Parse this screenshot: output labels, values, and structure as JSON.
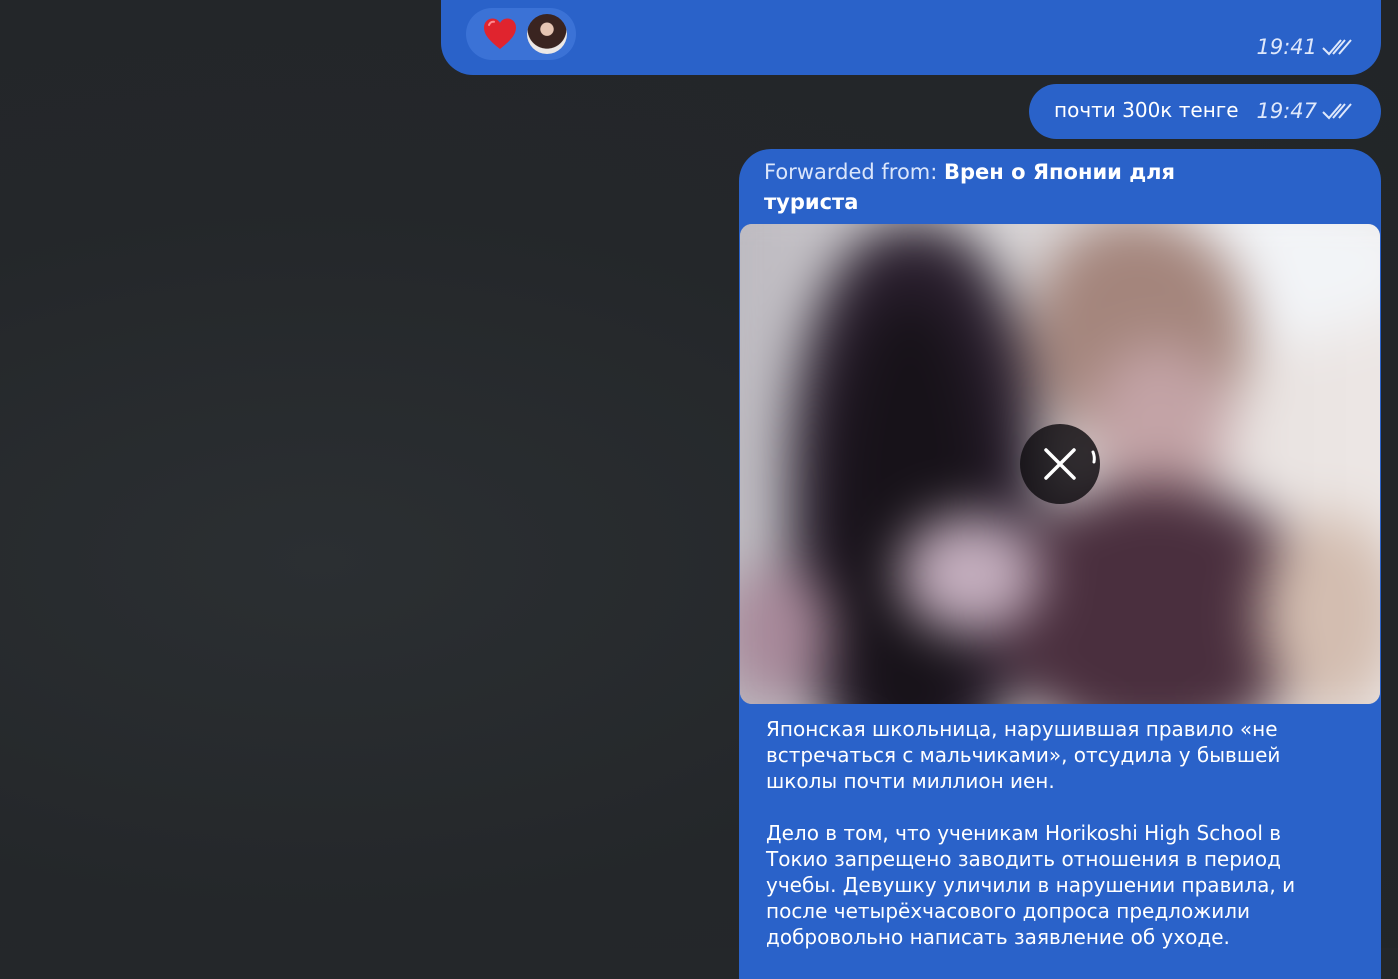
{
  "messages": [
    {
      "reactions": [
        {
          "emoji": "❤️",
          "icon": "red-heart-icon",
          "count_avatar": "reactor-avatar"
        }
      ],
      "time": "19:41",
      "status_icon": "double-check-icon"
    },
    {
      "text": "почти 300к тенге",
      "time": "19:47",
      "status_icon": "double-check-icon"
    },
    {
      "forwarded_prefix": "Forwarded from: ",
      "forwarded_from": "Врен о Японии для туриста",
      "media_action_icon": "close-icon",
      "caption_paragraphs": [
        "Японская школьница, нарушившая правило «не встречаться с мальчиками», отсудила у бывшей школы почти миллион иен.",
        "Дело в том, что ученикам Horikoshi High School в Токио запрещено заводить отношения в период учебы. Девушку уличили в нарушении правила, и после четырёхчасового допроса предложили добровольно написать заявление об уходе."
      ]
    }
  ],
  "colors": {
    "outgoing_bubble": "#2a62c9",
    "background": "#24272a",
    "reaction_pill": "#3b72d6"
  }
}
